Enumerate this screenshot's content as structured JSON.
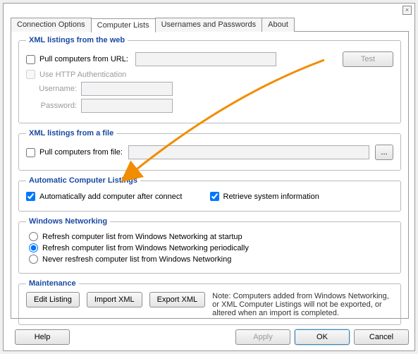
{
  "window": {
    "close": "×"
  },
  "tabs": {
    "connection": "Connection Options",
    "computer_lists": "Computer Lists",
    "usernames": "Usernames and Passwords",
    "about": "About"
  },
  "web": {
    "legend": "XML listings from the web",
    "pull_url_label": "Pull computers from URL:",
    "url_value": "",
    "test": "Test",
    "use_http_auth": "Use HTTP Authentication",
    "username_label": "Username:",
    "username_value": "",
    "password_label": "Password:",
    "password_value": ""
  },
  "file": {
    "legend": "XML listings from a file",
    "pull_file_label": "Pull computers from file:",
    "file_value": "",
    "browse": "..."
  },
  "auto": {
    "legend": "Automatic Computer Listings",
    "auto_add": "Automatically add computer after connect",
    "retrieve": "Retrieve system information"
  },
  "winnet": {
    "legend": "Windows Networking",
    "opt_startup": "Refresh computer list from Windows Networking at startup",
    "opt_periodic": "Refresh computer list from Windows Networking periodically",
    "opt_never": "Never resfresh computer list from Windows Networking"
  },
  "maint": {
    "legend": "Maintenance",
    "edit": "Edit Listing",
    "import": "Import XML",
    "export": "Export XML",
    "note": "Note: Computers added from Windows Networking, or XML Computer Listings will not be exported, or altered when an import is completed."
  },
  "buttons": {
    "help": "Help",
    "apply": "Apply",
    "ok": "OK",
    "cancel": "Cancel"
  },
  "annotation": {
    "arrow_color": "#f28c00"
  }
}
